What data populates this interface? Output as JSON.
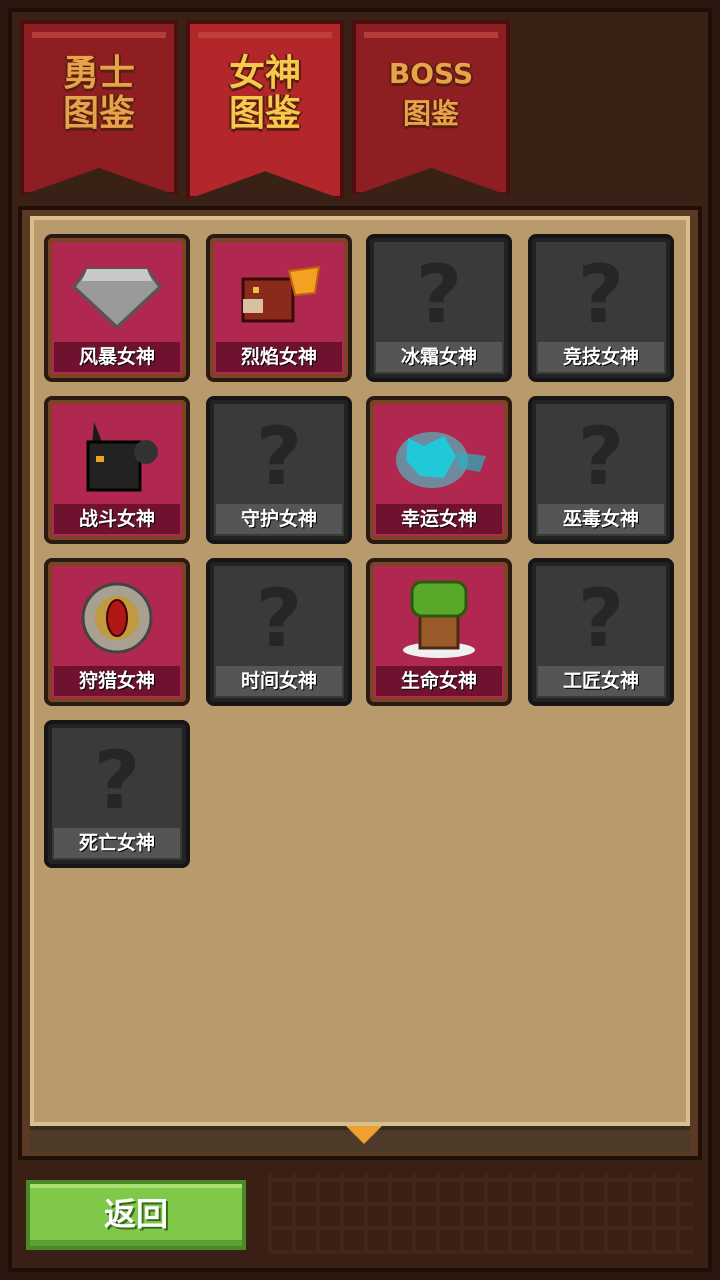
{
  "tabs": [
    {
      "label": "勇士\n图鉴",
      "active": false
    },
    {
      "label": "女神\n图鉴",
      "active": true
    },
    {
      "label": "BOSS\n图鉴",
      "active": false
    }
  ],
  "goddesses": [
    {
      "name": "风暴女神",
      "unlocked": true,
      "icon": "diamond-icon"
    },
    {
      "name": "烈焰女神",
      "unlocked": true,
      "icon": "fire-beast-icon"
    },
    {
      "name": "冰霜女神",
      "unlocked": false,
      "icon": "question-mark-icon"
    },
    {
      "name": "竞技女神",
      "unlocked": false,
      "icon": "question-mark-icon"
    },
    {
      "name": "战斗女神",
      "unlocked": true,
      "icon": "black-cat-icon"
    },
    {
      "name": "守护女神",
      "unlocked": false,
      "icon": "question-mark-icon"
    },
    {
      "name": "幸运女神",
      "unlocked": true,
      "icon": "cyan-spirit-icon"
    },
    {
      "name": "巫毒女神",
      "unlocked": false,
      "icon": "question-mark-icon"
    },
    {
      "name": "狩猎女神",
      "unlocked": true,
      "icon": "eye-crest-icon"
    },
    {
      "name": "时间女神",
      "unlocked": false,
      "icon": "question-mark-icon"
    },
    {
      "name": "生命女神",
      "unlocked": true,
      "icon": "tree-icon"
    },
    {
      "name": "工匠女神",
      "unlocked": false,
      "icon": "question-mark-icon"
    },
    {
      "name": "死亡女神",
      "unlocked": false,
      "icon": "question-mark-icon"
    }
  ],
  "locked_symbol": "?",
  "back_button": "返回"
}
